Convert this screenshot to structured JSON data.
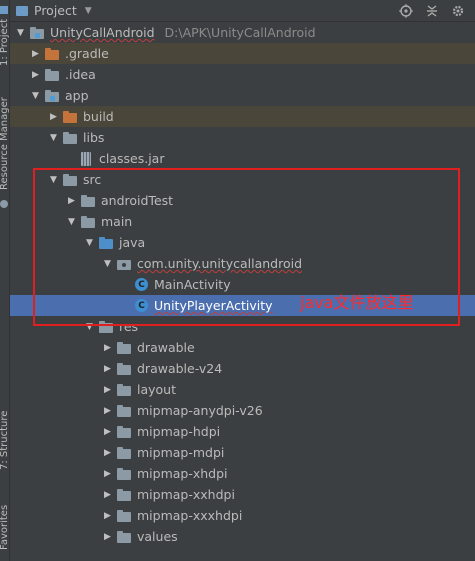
{
  "side_strip": {
    "project_label": "1: Project",
    "resource_label": "Resource Manager",
    "structure_label": "7: Structure",
    "favorites_label": "Favorites"
  },
  "header": {
    "title": "Project",
    "dropdown_glyph": "▼"
  },
  "tree": {
    "root": {
      "name": "UnityCallAndroid",
      "path": "D:\\APK\\UnityCallAndroid"
    },
    "gradle": ".gradle",
    "idea": ".idea",
    "app": "app",
    "build": "build",
    "libs": "libs",
    "classes_jar": "classes.jar",
    "src": "src",
    "android_test": "androidTest",
    "main": "main",
    "java": "java",
    "package": "com.unity.unitycallandroid",
    "main_activity": "MainActivity",
    "unity_player_activity": "UnityPlayerActivity",
    "res": "res",
    "res_children": [
      "drawable",
      "drawable-v24",
      "layout",
      "mipmap-anydpi-v26",
      "mipmap-hdpi",
      "mipmap-mdpi",
      "mipmap-xhdpi",
      "mipmap-xxhdpi",
      "mipmap-xxxhdpi",
      "values"
    ]
  },
  "annotation": {
    "text": "java文件放这里",
    "color": "#ff2a2a"
  },
  "colors": {
    "background": "#3c3f41",
    "selection": "#4b6eaf",
    "excluded_row": "#4a4639",
    "folder_orange": "#c4743b",
    "folder_blue": "#4f8fc9"
  }
}
